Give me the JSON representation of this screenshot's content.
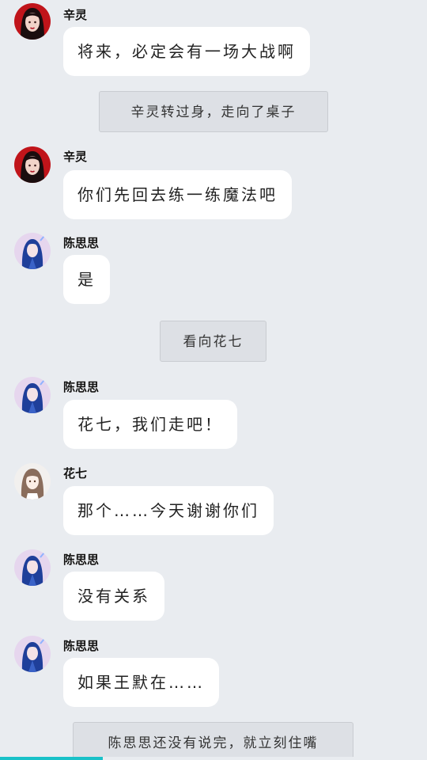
{
  "messages": [
    {
      "speaker": "辛灵",
      "text": "将来，必定会有一场大战啊"
    },
    {
      "narration": "辛灵转过身，走向了桌子"
    },
    {
      "speaker": "辛灵",
      "text": "你们先回去练一练魔法吧"
    },
    {
      "speaker": "陈思思",
      "text": "是"
    },
    {
      "narration": "看向花七"
    },
    {
      "speaker": "陈思思",
      "text": "花七，我们走吧！"
    },
    {
      "speaker": "花七",
      "text": "那个……今天谢谢你们"
    },
    {
      "speaker": "陈思思",
      "text": "没有关系"
    },
    {
      "speaker": "陈思思",
      "text": "如果王默在……"
    },
    {
      "narration": "陈思思还没有说完，就立刻住嘴"
    }
  ],
  "avatars": {
    "xinling": "dark-haired-woman-avatar",
    "chensisi": "blue-haired-girl-avatar",
    "huaqi": "brown-haired-girl-avatar"
  },
  "progress": 0.24,
  "colors": {
    "background": "#e9ecf0",
    "bubble": "#ffffff",
    "narration_bg": "#dde0e5",
    "progress": "#19c1c8"
  }
}
